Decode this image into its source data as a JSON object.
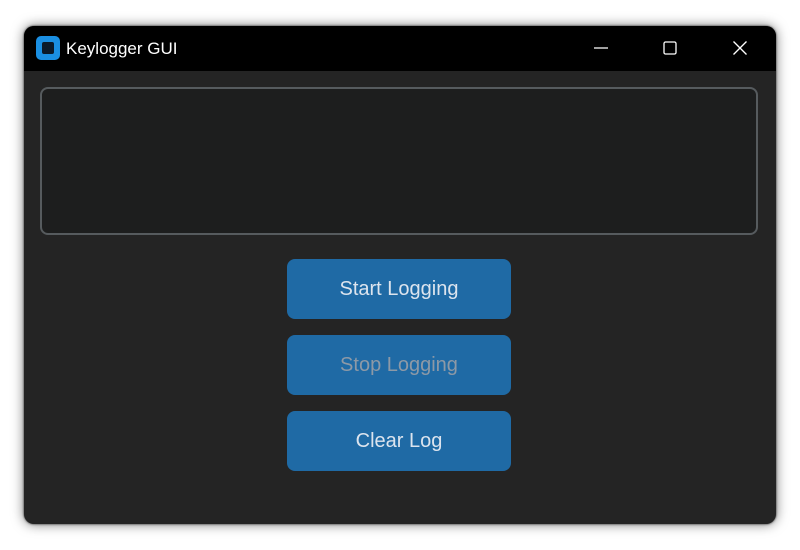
{
  "window": {
    "title": "Keylogger GUI",
    "controls": {
      "minimize_icon": "minimize-icon",
      "maximize_icon": "maximize-icon",
      "close_icon": "close-icon"
    }
  },
  "log_box": {
    "value": ""
  },
  "buttons": {
    "start_label": "Start Logging",
    "stop_label": "Stop Logging",
    "clear_label": "Clear Log"
  },
  "colors": {
    "window_bg": "#242424",
    "titlebar_bg": "#000000",
    "button_bg": "#1f6aa5",
    "button_text": "#dce4ee",
    "button_disabled_text": "#8d99a6",
    "textbox_bg": "#1d1e1e",
    "textbox_border": "#565b5e",
    "app_icon": "#1a8fe3"
  },
  "states": {
    "stop_button_enabled": false
  }
}
